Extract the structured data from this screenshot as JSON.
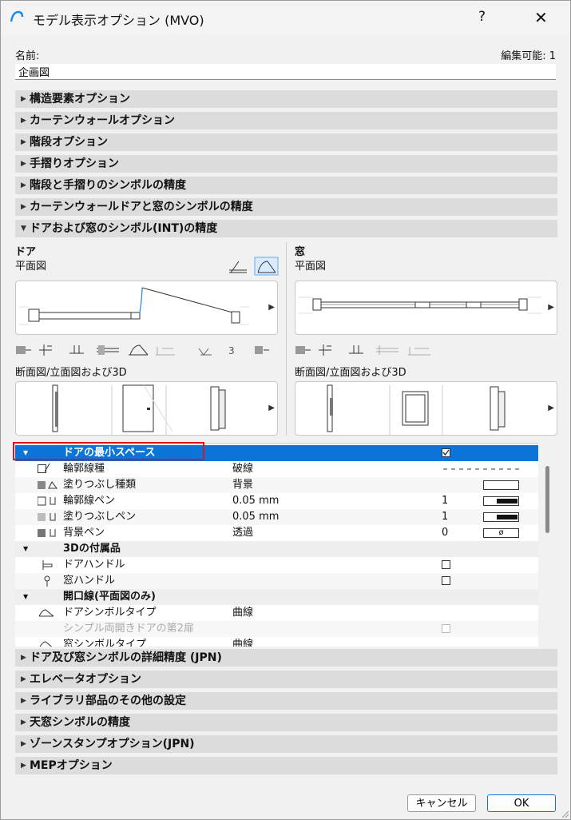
{
  "window": {
    "title": "モデル表示オプション (MVO)",
    "help": "?",
    "close": "✕"
  },
  "name": {
    "label": "名前:",
    "value": "企画図",
    "edit_count": "編集可能: 1"
  },
  "sections_top": [
    "構造要素オプション",
    "カーテンウォールオプション",
    "階段オプション",
    "手摺りオプション",
    "階段と手摺りのシンボルの精度",
    "カーテンウォールドアと窓のシンボルの精度"
  ],
  "expanded_section": "ドアおよび窓のシンボル(INT)の精度",
  "door_panel": {
    "title": "ドア",
    "plan_label": "平面図",
    "section_label": "断面図/立面図および3D",
    "counter": "3"
  },
  "window_panel": {
    "title": "窓",
    "plan_label": "平面図",
    "section_label": "断面図/立面図および3D"
  },
  "tree": {
    "selected": {
      "label": "ドアの最小スペース"
    },
    "rows_1": [
      {
        "label": "輪郭線種",
        "value": "破線",
        "num": ""
      },
      {
        "label": "塗りつぶし種類",
        "value": "背景",
        "num": ""
      },
      {
        "label": "輪郭線ペン",
        "value": "0.05 mm",
        "num": "1"
      },
      {
        "label": "塗りつぶしペン",
        "value": "0.05 mm",
        "num": "1"
      },
      {
        "label": "背景ペン",
        "value": "透過",
        "num": "0"
      }
    ],
    "group_3d": "3Dの付属品",
    "rows_3d": [
      {
        "label": "ドアハンドル"
      },
      {
        "label": "窓ハンドル"
      }
    ],
    "group_opening": "開口線(平面図のみ)",
    "rows_opening": [
      {
        "label": "ドアシンボルタイプ",
        "value": "曲線"
      },
      {
        "label": "シンプル両開きドアの第2扉",
        "value": ""
      },
      {
        "label": "窓シンボルタイプ",
        "value": "曲線"
      }
    ]
  },
  "sections_bottom": [
    "ドア及び窓シンボルの詳細精度 (JPN)",
    "エレベータオプション",
    "ライブラリ部品のその他の設定",
    "天窓シンボルの精度",
    "ゾーンスタンプオプション(JPN)",
    "MEPオプション"
  ],
  "buttons": {
    "cancel": "キャンセル",
    "ok": "OK"
  },
  "colors": {
    "selection": "#0a74d8",
    "highlight": "#e0101e",
    "accent_blue": "#1a6fd0"
  }
}
